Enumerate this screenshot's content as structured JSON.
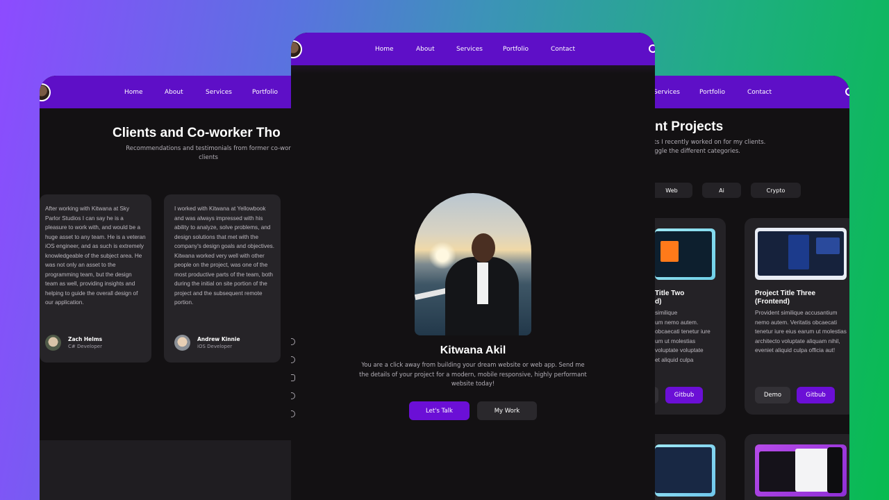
{
  "colors": {
    "nav_bg": "#5e0fc7",
    "panel_bg": "#131113",
    "card_bg": "#242226",
    "accent_button": "#6b0fd6"
  },
  "left": {
    "nav": [
      "Home",
      "About",
      "Services",
      "Portfolio"
    ],
    "title": "Clients and Co-worker Tho",
    "subtitle": "Recommendations and testimonials from former co-wor clients",
    "testimonials": [
      {
        "text": "After working with Kitwana at Sky Parlor Studios I can say he is a pleasure to work with, and would be a huge asset to any team. He is a veteran iOS engineer, and as such is extremely knowledgeable of the subject area. He was not only an asset to the programming team, but the design team as well, providing insights and helping to guide the overall design of our application.",
        "name": "Zach Helms",
        "role": "C# Developer"
      },
      {
        "text": "I worked with Kitwana at Yellowbook and was always impressed with his ability to analyze, solve problems, and design solutions that met with the company's design goals and objectives. Kitwana worked very well with other people on the project, was one of the most productive parts of the team, both during the initial on site portion of the project and the subsequent remote portion.",
        "name": "Andrew Kinnie",
        "role": "iOS Developer"
      }
    ]
  },
  "center": {
    "nav": [
      "Home",
      "About",
      "Services",
      "Portfolio",
      "Contact"
    ],
    "name": "Kitwana Akil",
    "description": "You are a click away from building your dream website or web app. Send me the details of your project for a modern, mobile responsive, highly performant website today!",
    "primary_button": "Let's Talk",
    "secondary_button": "My Work",
    "social_icons": [
      "dribbble-icon",
      "twitter-icon",
      "instagram-icon",
      "github-icon",
      "codepen-icon"
    ]
  },
  "right": {
    "nav": [
      "Services",
      "Portfolio",
      "Contact"
    ],
    "title": "nt Projects",
    "subtitle_line1": "cts I recently worked on for my clients.",
    "subtitle_line2": "oggle the different categories.",
    "categories": [
      "Web",
      "Ai",
      "Crypto"
    ],
    "projects": [
      {
        "title": "Title Two\nd)",
        "description": "similique\num nemo autem.\nobcaecati tenetur iure\num ut molestias\nvoluptate voluptate\net aliquid culpa",
        "github": "Gitbub"
      },
      {
        "title": "Project Title Three\n(Frontend)",
        "description": "Provident similique accusantium nemo autem. Veritatis obcaecati tenetur iure eius earum ut molestias architecto voluptate aliquam nihil, eveniet aliquid culpa officia aut!",
        "demo": "Demo",
        "github": "Gitbub"
      }
    ]
  }
}
